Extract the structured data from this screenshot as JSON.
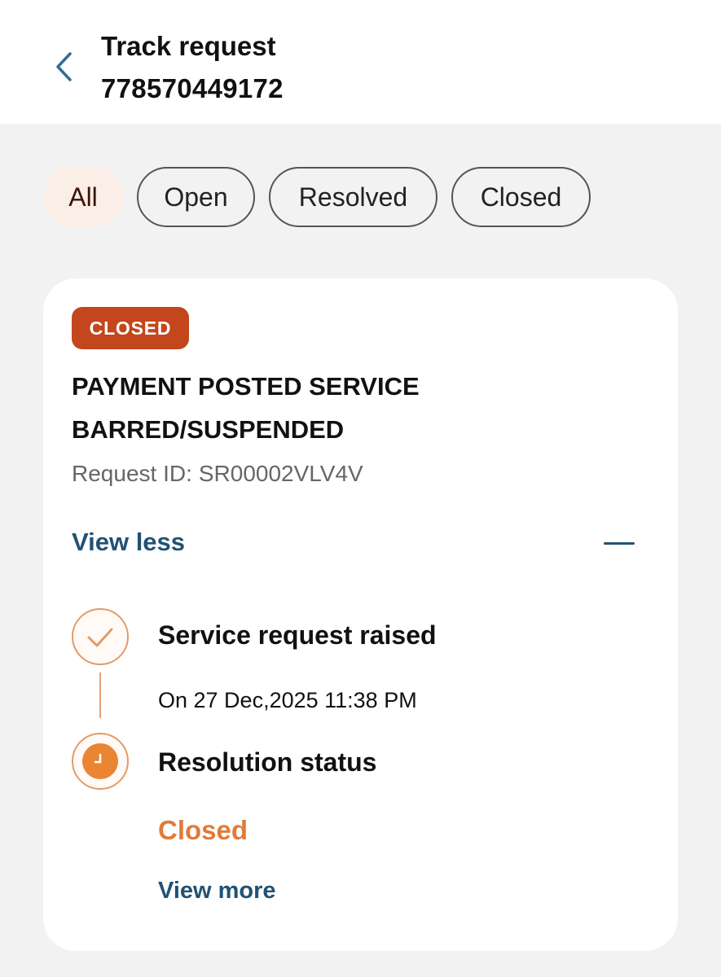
{
  "header": {
    "title": "Track request",
    "account_number": "778570449172",
    "back_icon": "chevron-left-icon"
  },
  "filters": {
    "items": [
      {
        "label": "All",
        "selected": true
      },
      {
        "label": "Open",
        "selected": false
      },
      {
        "label": "Resolved",
        "selected": false
      },
      {
        "label": "Closed",
        "selected": false
      }
    ]
  },
  "request": {
    "status_badge": "CLOSED",
    "title": "PAYMENT POSTED SERVICE BARRED/SUSPENDED",
    "id_label": "Request ID:",
    "id_value": "SR00002VLV4V",
    "toggle_label": "View less",
    "toggle_icon": "minus-icon",
    "timeline": {
      "step1": {
        "title": "Service request raised",
        "date": "On 27 Dec,2025 11:38 PM",
        "icon": "check-icon"
      },
      "step2": {
        "title": "Resolution status",
        "status": "Closed",
        "icon": "clock-icon"
      }
    },
    "more_label": "View more"
  },
  "colors": {
    "accent_blue": "#215274",
    "badge_closed": "#c4461c",
    "timeline_orange": "#e07b38",
    "chip_active_bg": "#fbeee6"
  }
}
